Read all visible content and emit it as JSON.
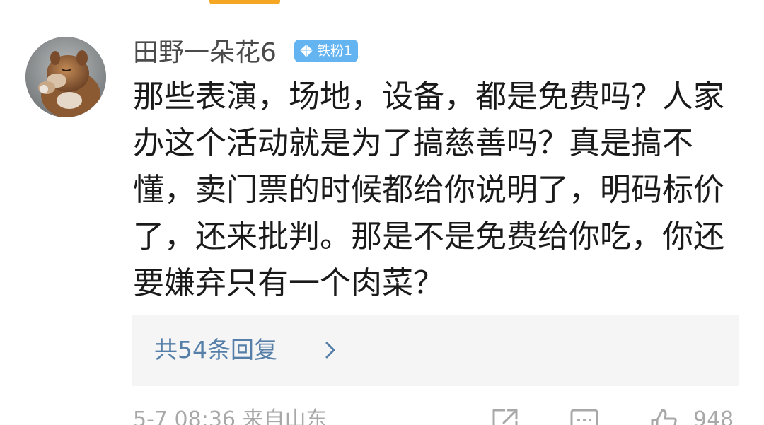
{
  "comment": {
    "user": {
      "name": "田野一朵花6",
      "avatar": "squirrel-photo",
      "badge": {
        "label": "铁粉1",
        "icon": "diamond-icon",
        "color": "#64b4f2"
      }
    },
    "text": "那些表演，场地，设备，都是免费吗？人家办这个活动就是为了搞慈善吗？真是搞不懂，卖门票的时候都给你说明了，明码标价了，还来批判。那是不是免费给你吃，你还要嫌弃只有一个肉菜？",
    "replies_label": "共54条回复",
    "meta": "5-7 08:36 来自山东",
    "likes": "948"
  },
  "colors": {
    "accent_tab": "#f5a623",
    "link": "#557fa8",
    "meta_gray": "#a8a8a8",
    "text": "#1a1a1a"
  },
  "icons": [
    "share-icon",
    "comment-icon",
    "like-icon",
    "chevron-right-icon"
  ]
}
